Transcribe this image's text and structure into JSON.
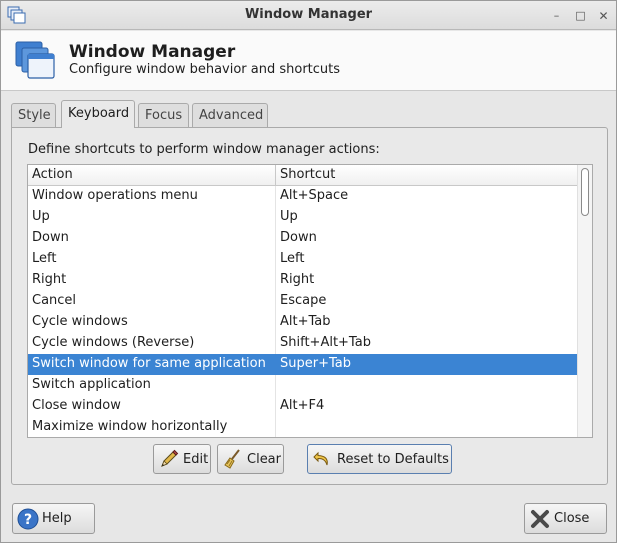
{
  "window": {
    "title": "Window Manager",
    "controls": [
      "minimize",
      "maximize",
      "close"
    ]
  },
  "header": {
    "title": "Window Manager",
    "subtitle": "Configure window behavior and shortcuts"
  },
  "tabs": [
    {
      "label": "Style",
      "active": false
    },
    {
      "label": "Keyboard",
      "active": true
    },
    {
      "label": "Focus",
      "active": false
    },
    {
      "label": "Advanced",
      "active": false
    }
  ],
  "keyboard": {
    "description": "Define shortcuts to perform window manager actions:",
    "columns": {
      "action": "Action",
      "shortcut": "Shortcut"
    },
    "rows": [
      {
        "action": "Window operations menu",
        "shortcut": "Alt+Space",
        "selected": false
      },
      {
        "action": "Up",
        "shortcut": "Up",
        "selected": false
      },
      {
        "action": "Down",
        "shortcut": "Down",
        "selected": false
      },
      {
        "action": "Left",
        "shortcut": "Left",
        "selected": false
      },
      {
        "action": "Right",
        "shortcut": "Right",
        "selected": false
      },
      {
        "action": "Cancel",
        "shortcut": "Escape",
        "selected": false
      },
      {
        "action": "Cycle windows",
        "shortcut": "Alt+Tab",
        "selected": false
      },
      {
        "action": "Cycle windows (Reverse)",
        "shortcut": "Shift+Alt+Tab",
        "selected": false
      },
      {
        "action": "Switch window for same application",
        "shortcut": "Super+Tab",
        "selected": true
      },
      {
        "action": "Switch application",
        "shortcut": "",
        "selected": false
      },
      {
        "action": "Close window",
        "shortcut": "Alt+F4",
        "selected": false
      },
      {
        "action": "Maximize window horizontally",
        "shortcut": "",
        "selected": false
      }
    ],
    "buttons": {
      "edit": "Edit",
      "clear": "Clear",
      "reset": "Reset to Defaults"
    }
  },
  "footer": {
    "help": "Help",
    "close": "Close"
  },
  "icons": {
    "app": "window-manager-icon",
    "edit": "pencil-icon",
    "clear": "broom-icon",
    "reset": "undo-arrow-icon",
    "help": "help-question-icon",
    "close": "close-x-icon"
  },
  "colors": {
    "selection": "#3b84d3",
    "help_icon": "#3a74c7",
    "window_bg": "#e7e7e7"
  }
}
